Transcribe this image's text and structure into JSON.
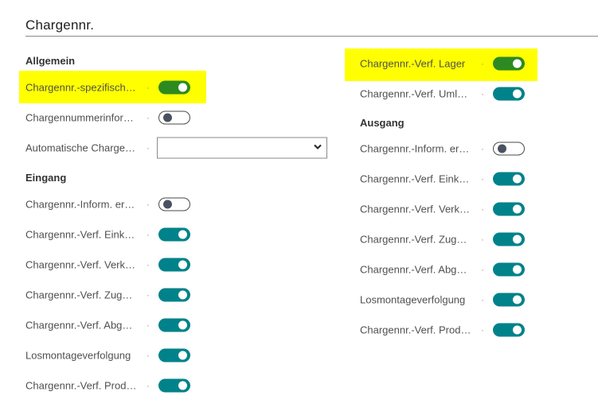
{
  "section": {
    "title": "Chargennr."
  },
  "left": {
    "general": {
      "heading": "Allgemein",
      "rows": [
        {
          "label": "Chargennr.-spezifisch…",
          "toggle": "on",
          "highlight": true,
          "accent": "green"
        },
        {
          "label": "Chargennummerinfor…",
          "toggle": "off"
        },
        {
          "label": "Automatische Charge…",
          "select_value": ""
        }
      ]
    },
    "inbound": {
      "heading": "Eingang",
      "rows": [
        {
          "label": "Chargennr.-Inform. er…",
          "toggle": "off"
        },
        {
          "label": "Chargennr.-Verf. Eink…",
          "toggle": "on"
        },
        {
          "label": "Chargennr.-Verf. Verk…",
          "toggle": "on"
        },
        {
          "label": "Chargennr.-Verf. Zug…",
          "toggle": "on"
        },
        {
          "label": "Chargennr.-Verf. Abg…",
          "toggle": "on"
        },
        {
          "label": "Losmontageverfolgung",
          "toggle": "on"
        },
        {
          "label": "Chargennr.-Verf. Prod…",
          "toggle": "on"
        }
      ]
    }
  },
  "right": {
    "warehouse_rows": [
      {
        "label": "Chargennr.-Verf. Lager",
        "toggle": "on",
        "highlight": true,
        "accent": "green"
      },
      {
        "label": "Chargennr.-Verf. Uml…",
        "toggle": "on"
      }
    ],
    "outbound": {
      "heading": "Ausgang",
      "rows": [
        {
          "label": "Chargennr.-Inform. er…",
          "toggle": "off"
        },
        {
          "label": "Chargennr.-Verf. Eink…",
          "toggle": "on"
        },
        {
          "label": "Chargennr.-Verf. Verk…",
          "toggle": "on"
        },
        {
          "label": "Chargennr.-Verf. Zug…",
          "toggle": "on"
        },
        {
          "label": "Chargennr.-Verf. Abg…",
          "toggle": "on"
        },
        {
          "label": "Losmontageverfolgung",
          "toggle": "on"
        },
        {
          "label": "Chargennr.-Verf. Prod…",
          "toggle": "on"
        }
      ]
    }
  },
  "separator_dot": "·",
  "colors": {
    "toggle_on": "#00828a",
    "toggle_on_highlight": "#2d8a21",
    "highlight": "#ffff00",
    "rule": "#8a8a8a"
  }
}
